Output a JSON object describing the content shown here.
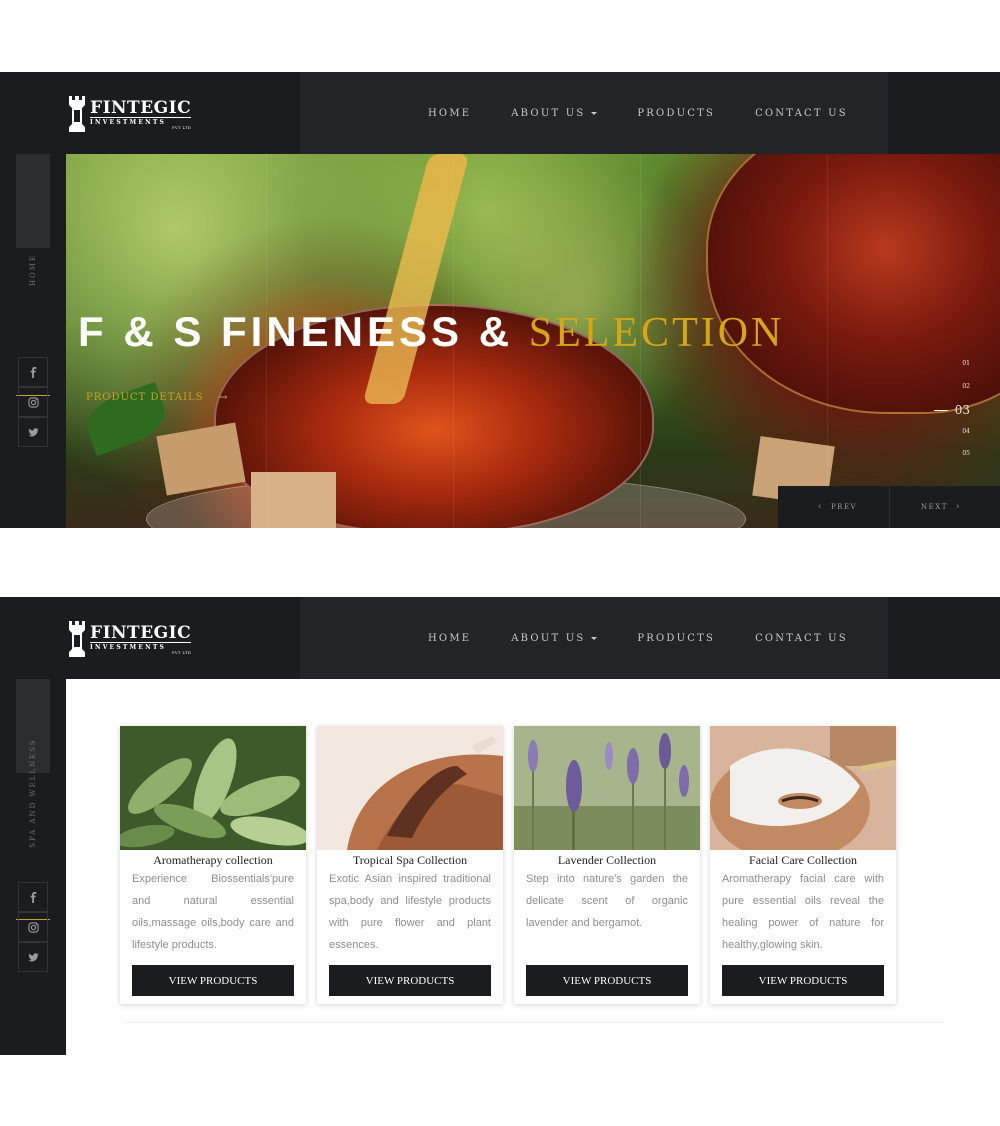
{
  "brand": {
    "name": "FINTEGIC",
    "tagline": "INVESTMENTS",
    "suffix": "PVT LTD"
  },
  "nav": {
    "home": "HOME",
    "about": "ABOUT US",
    "products": "PRODUCTS",
    "contact": "CONTACT US"
  },
  "screen1": {
    "side_label": "HOME",
    "hero": {
      "title_white": "F & S FINENESS &",
      "title_gold": "SELECTION",
      "details_link": "PRODUCT DETAILS",
      "details_arrow": "→"
    },
    "pager": [
      "01",
      "02",
      "03",
      "04",
      "05"
    ],
    "active_slide": "03",
    "prev_label": "PREV",
    "next_label": "NEXT"
  },
  "screen2": {
    "side_label": "SPA AND WELLNESS",
    "cards": [
      {
        "title": "Aromatherapy collection",
        "desc": "Experience Biossentials'pure and natural essential oils,massage oils,body care and lifestyle products.",
        "button": "VIEW PRODUCTS"
      },
      {
        "title": "Tropical Spa Collection",
        "desc": "Exotic Asian inspired traditional spa,body and lifestyle products with pure flower and plant essences.",
        "button": "VIEW PRODUCTS"
      },
      {
        "title": "Lavender Collection",
        "desc": "Step into nature's garden the delicate scent of organic lavender and bergamot.",
        "button": "VIEW PRODUCTS"
      },
      {
        "title": "Facial Care Collection",
        "desc": "Aromatherapy facial care with pure essential oils reveal the healing power of nature for healthy,glowing skin.",
        "button": "VIEW PRODUCTS"
      }
    ]
  },
  "icons": {
    "social": [
      "facebook-icon",
      "instagram-icon",
      "twitter-icon"
    ],
    "logo": "rook-icon"
  },
  "colors": {
    "dark": "#1b1c1e",
    "nav_bg": "#232427",
    "accent_gold": "#d6a619"
  }
}
